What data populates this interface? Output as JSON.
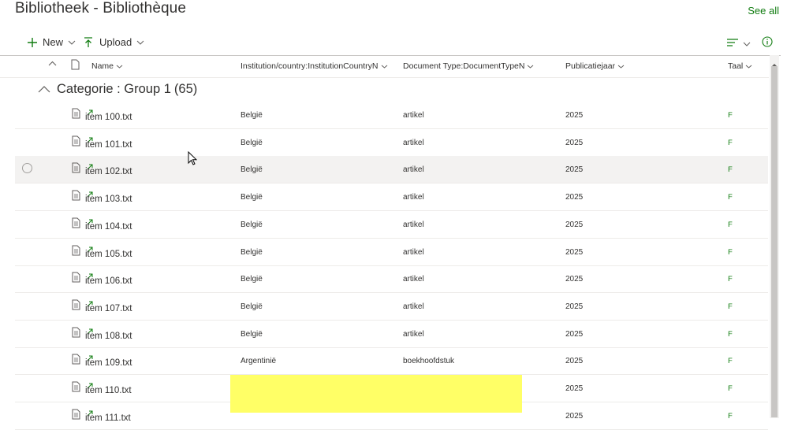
{
  "header": {
    "title": "Bibliotheek - Bibliothèque",
    "see_all": "See all"
  },
  "toolbar": {
    "new_label": "New",
    "upload_label": "Upload"
  },
  "columns": {
    "name": "Name",
    "institution": "Institution/country:InstitutionCountryN",
    "doctype": "Document Type:DocumentTypeN",
    "year": "Publicatiejaar",
    "taal": "Taal"
  },
  "group": {
    "label": "Categorie : Group 1",
    "count": "(65)"
  },
  "rows": [
    {
      "name": "item 100.txt",
      "institution": "België",
      "doctype": "artikel",
      "year": "2025",
      "taal": "F"
    },
    {
      "name": "item 101.txt",
      "institution": "België",
      "doctype": "artikel",
      "year": "2025",
      "taal": "F"
    },
    {
      "name": "item 102.txt",
      "institution": "België",
      "doctype": "artikel",
      "year": "2025",
      "taal": "F"
    },
    {
      "name": "item 103.txt",
      "institution": "België",
      "doctype": "artikel",
      "year": "2025",
      "taal": "F"
    },
    {
      "name": "item 104.txt",
      "institution": "België",
      "doctype": "artikel",
      "year": "2025",
      "taal": "F"
    },
    {
      "name": "item 105.txt",
      "institution": "België",
      "doctype": "artikel",
      "year": "2025",
      "taal": "F"
    },
    {
      "name": "item 106.txt",
      "institution": "België",
      "doctype": "artikel",
      "year": "2025",
      "taal": "F"
    },
    {
      "name": "item 107.txt",
      "institution": "België",
      "doctype": "artikel",
      "year": "2025",
      "taal": "F"
    },
    {
      "name": "item 108.txt",
      "institution": "België",
      "doctype": "artikel",
      "year": "2025",
      "taal": "F"
    },
    {
      "name": "item 109.txt",
      "institution": "Argentinië",
      "doctype": "boekhoofdstuk",
      "year": "2025",
      "taal": "F"
    },
    {
      "name": "item 110.txt",
      "institution": "",
      "doctype": "",
      "year": "2025",
      "taal": "F"
    },
    {
      "name": "item 111.txt",
      "institution": "",
      "doctype": "",
      "year": "2025",
      "taal": "F"
    }
  ],
  "colors": {
    "accent_green": "#107c10",
    "highlight": "#ffff66"
  }
}
